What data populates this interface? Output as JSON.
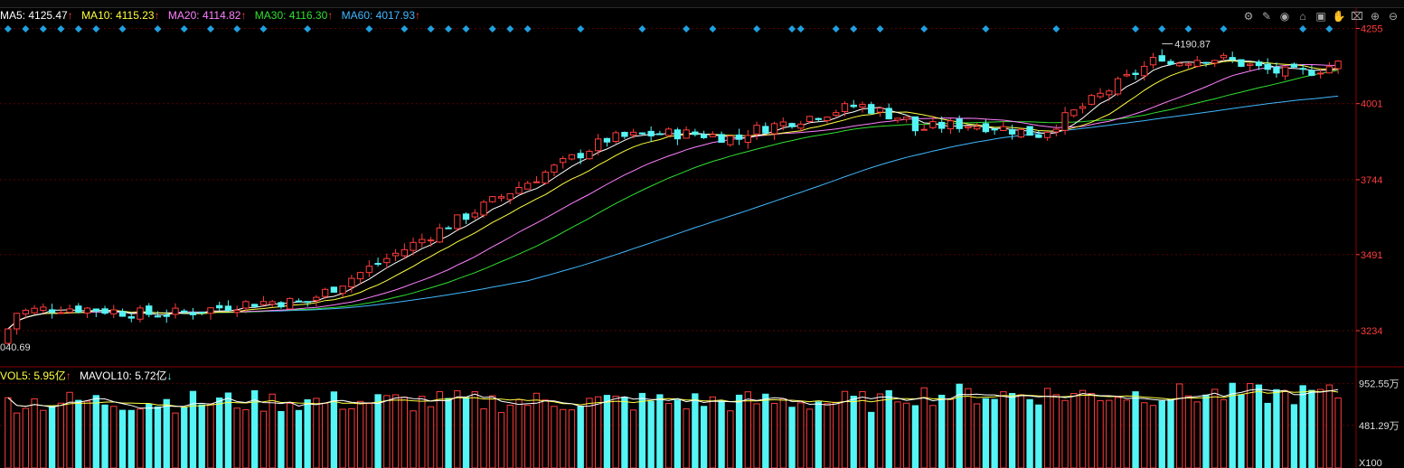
{
  "colors": {
    "up": "#ff3c3c",
    "down": "#55f5f5",
    "ma5": "#ffffff",
    "ma10": "#ffff40",
    "ma20": "#ff80ff",
    "ma30": "#30e030",
    "ma60": "#40b8ff",
    "axis_text": "#ff3c3c",
    "grid": "#5a0000",
    "marker": "#20a0e0",
    "vol_ma5": "#ffffff",
    "vol_ma10": "#ffff40"
  },
  "indicators": {
    "ma5": {
      "label": "MA5: 4125.47",
      "arrow": "↑"
    },
    "ma10": {
      "label": "MA10: 4115.23",
      "arrow": "↑"
    },
    "ma20": {
      "label": "MA20: 4114.82",
      "arrow": "↑"
    },
    "ma30": {
      "label": "MA30: 4116.30",
      "arrow": "↑"
    },
    "ma60": {
      "label": "MA60: 4017.93",
      "arrow": "↑"
    }
  },
  "volume_indicators": {
    "vol5": {
      "label": "VOL5: 5.95亿",
      "arrow": "↑"
    },
    "mavol10": {
      "label": "MAVOL10: 5.72亿",
      "arrow": "↓"
    }
  },
  "toolbar": {
    "icons": [
      "settings-icon",
      "draw-icon",
      "eye-icon",
      "lock-icon",
      "lock2-icon",
      "hand-icon",
      "lock3-icon",
      "zoom-in-icon",
      "zoom-out-icon"
    ]
  },
  "chart_data": {
    "type": "candlestick",
    "price_axis": {
      "ticks": [
        "4255",
        "4001",
        "3744",
        "3491",
        "3234"
      ],
      "tick_values": [
        4255,
        4001,
        3744,
        3491,
        3234
      ],
      "range": [
        3115,
        4290
      ]
    },
    "volume_axis": {
      "ticks": [
        "952.55万",
        "481.29万"
      ],
      "tick_values": [
        952.55,
        481.29
      ],
      "unit_label": "X100",
      "range": [
        0,
        1000
      ]
    },
    "annotations": {
      "high": "4190.87",
      "low": "040.69"
    },
    "n_candles": 152,
    "marker_indices": [
      0,
      2,
      4,
      6,
      8,
      10,
      13,
      17,
      20,
      23,
      26,
      29,
      34,
      41,
      45,
      48,
      50,
      52,
      55,
      57,
      59,
      65,
      72,
      77,
      80,
      85,
      89,
      90,
      94,
      96,
      99,
      104,
      111,
      119,
      128,
      131,
      134,
      138,
      147,
      150
    ]
  }
}
